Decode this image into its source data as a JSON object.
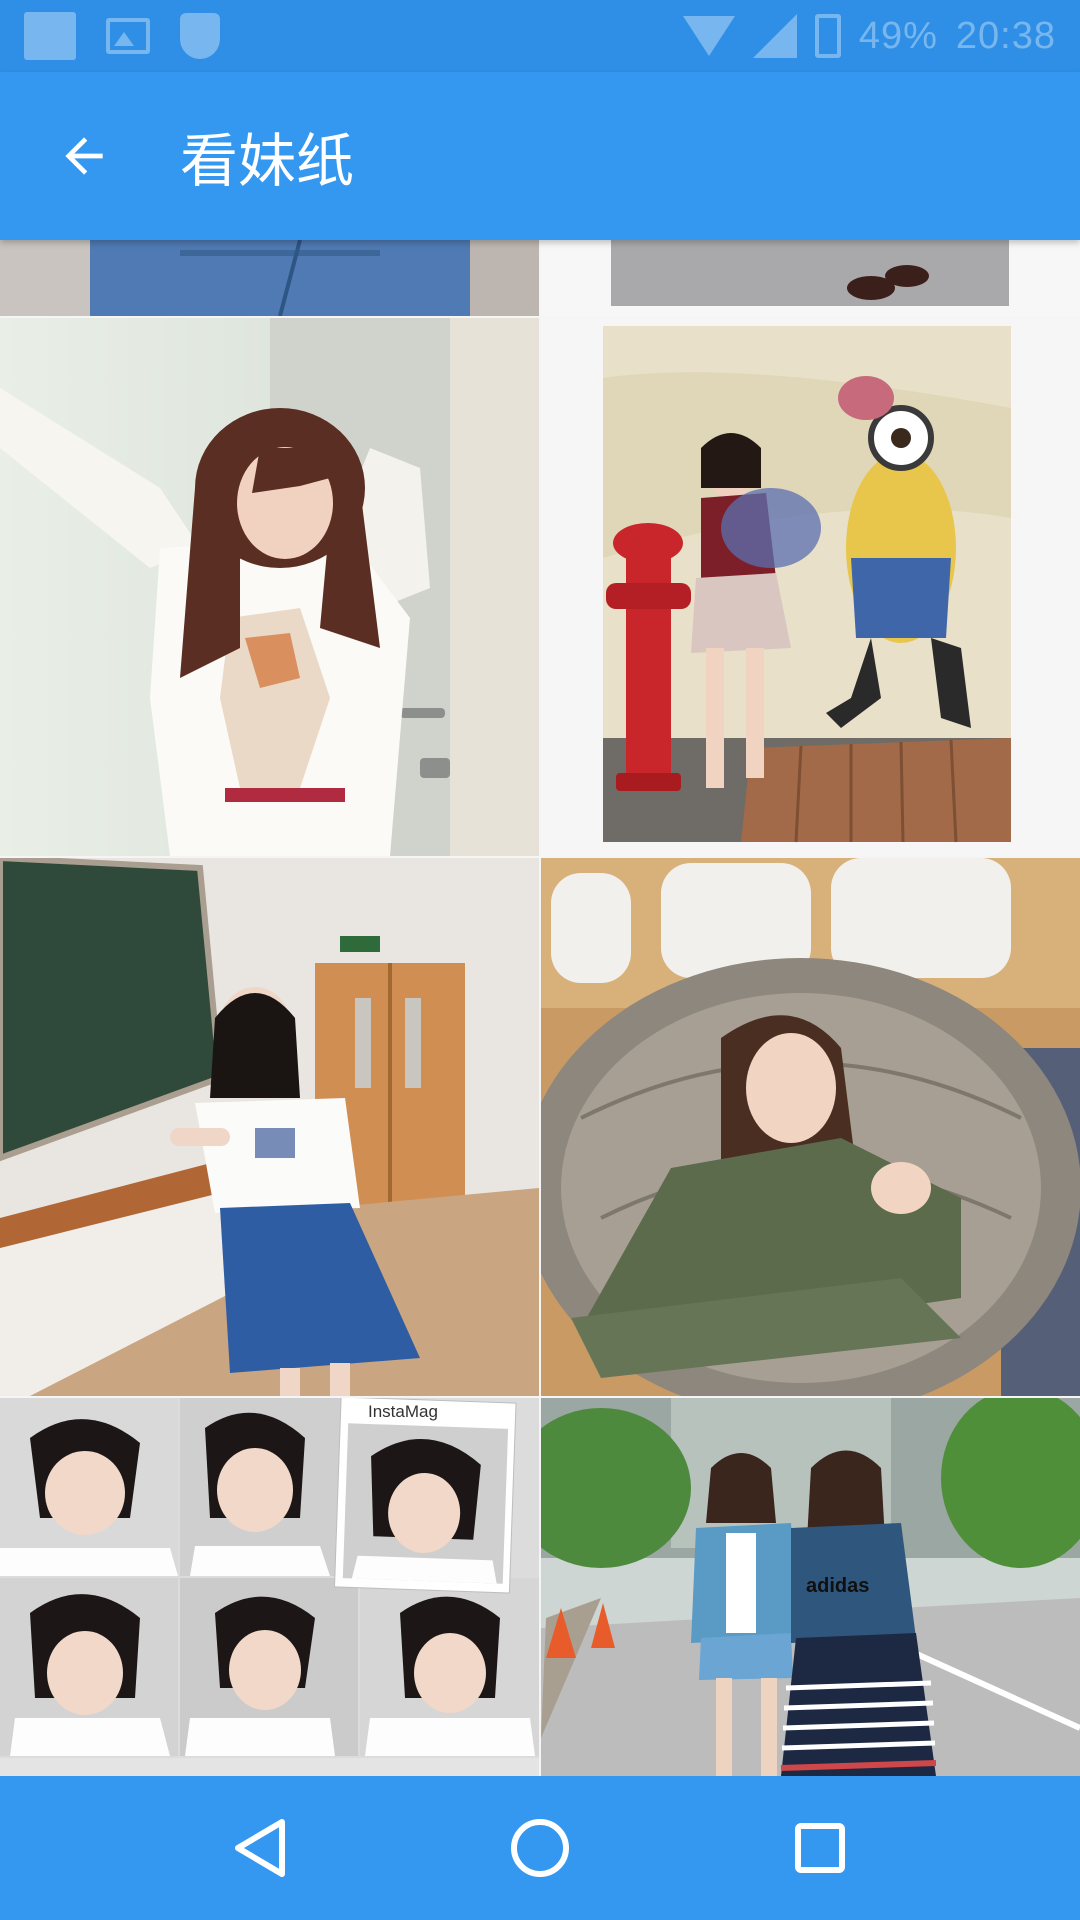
{
  "status_bar": {
    "battery_percent": "49%",
    "time": "20:38",
    "icons": [
      "notification-square-icon",
      "image-icon",
      "shield-icon",
      "wifi-icon",
      "signal-icon",
      "battery-icon"
    ]
  },
  "app_bar": {
    "back_icon": "arrow-left-icon",
    "title": "看妹纸"
  },
  "gallery": {
    "tiles": [
      {
        "name": "photo-partial-left-top",
        "caption": ""
      },
      {
        "name": "photo-partial-right-top",
        "caption": ""
      },
      {
        "name": "photo-girl-white-lace-top",
        "caption": ""
      },
      {
        "name": "photo-girl-hydrant-minion-wall",
        "caption": ""
      },
      {
        "name": "photo-girl-classroom-denim-skirt",
        "caption": ""
      },
      {
        "name": "photo-girl-papasan-chair",
        "caption": ""
      },
      {
        "name": "photo-short-hair-collage",
        "caption": "InstaMag"
      },
      {
        "name": "photo-two-girls-street",
        "caption": "adidas"
      }
    ]
  },
  "nav_bar": {
    "icons": [
      "back-triangle-icon",
      "home-circle-icon",
      "recents-square-icon"
    ]
  },
  "colors": {
    "primary": "#3497f0",
    "primary_dark": "#2f8fe6",
    "background": "#f5f5f5"
  }
}
